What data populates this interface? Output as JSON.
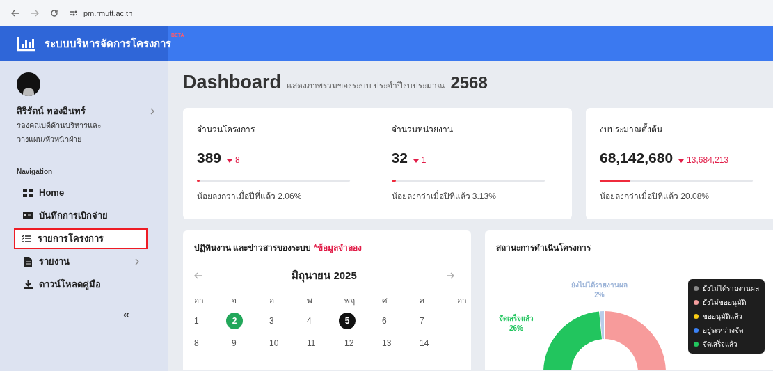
{
  "browser": {
    "url": "pm.rmutt.ac.th"
  },
  "header": {
    "title": "ระบบบริหารจัดการโครงการ",
    "badge": "BETA"
  },
  "user": {
    "name": "สิริรัตน์ ทองอินทร์",
    "role": "รองคณบดีด้านบริหารและวางแผน/หัวหน้าฝ่าย"
  },
  "nav": {
    "heading": "Navigation",
    "items": [
      {
        "label": "Home",
        "kind": "grid",
        "selected": false,
        "expandable": false
      },
      {
        "label": "บันทึกการเบิกจ่าย",
        "kind": "card",
        "selected": false,
        "expandable": false
      },
      {
        "label": "รายการโครงการ",
        "kind": "list",
        "selected": true,
        "expandable": false
      },
      {
        "label": "รายงาน",
        "kind": "file",
        "selected": false,
        "expandable": true
      },
      {
        "label": "ดาวน์โหลดคู่มือ",
        "kind": "download",
        "selected": false,
        "expandable": false
      }
    ],
    "collapse": "«"
  },
  "dashboard": {
    "title": "Dashboard",
    "subtitle": "แสดงภาพรวมของระบบ ประจำปีงบประมาณ",
    "year": "2568"
  },
  "stats": [
    {
      "label": "จำนวนโครงการ",
      "value": "389",
      "change": "8",
      "level": 0.02,
      "note": "น้อยลงกว่าเมื่อปีที่แล้ว 2.06%"
    },
    {
      "label": "จำนวนหน่วยงาน",
      "value": "32",
      "change": "1",
      "level": 0.03,
      "note": "น้อยลงกว่าเมื่อปีที่แล้ว 3.13%"
    },
    {
      "label": "งบประมาณตั้งต้น",
      "value": "68,142,680",
      "change": "13,684,213",
      "level": 0.2,
      "note": "น้อยลงกว่าเมื่อปีที่แล้ว 20.08%"
    }
  ],
  "calendar": {
    "title": "ปฏิทินงาน และข่าวสารของระบบ",
    "title_note": "*ข้อมูลจำลอง",
    "month": "มิถุนายน 2025",
    "weekdays": [
      "อา",
      "จ",
      "อ",
      "พ",
      "พฤ",
      "ศ",
      "ส",
      "อา"
    ],
    "weeks": [
      [
        {
          "day": "1"
        },
        {
          "day": "2",
          "color": "#22a75a"
        },
        {
          "day": "3"
        },
        {
          "day": "4"
        },
        {
          "day": "5",
          "color": "#111111"
        },
        {
          "day": "6"
        },
        {
          "day": "7"
        }
      ],
      [
        {
          "day": "8"
        },
        {
          "day": "9"
        },
        {
          "day": "10"
        },
        {
          "day": "11"
        },
        {
          "day": "12"
        },
        {
          "day": "13"
        },
        {
          "day": "14"
        }
      ]
    ]
  },
  "status": {
    "title": "สถานะการดำเนินโครงการ",
    "labels": [
      {
        "name": "ยังไม่ได้รายงานผล",
        "value": "2%",
        "color": "#9cb4d8"
      },
      {
        "name": "จัดเสร็จแล้ว",
        "value": "26%",
        "color": "#22c55e"
      }
    ],
    "legend": [
      {
        "label": "ยังไม่ได้รายงานผล",
        "color": "#8a8a8a"
      },
      {
        "label": "ยังไม่ขออนุมัติ",
        "color": "#f59e9e"
      },
      {
        "label": "ขออนุมัติแล้ว",
        "color": "#facc15"
      },
      {
        "label": "อยู่ระหว่างจัด",
        "color": "#3b82f6"
      },
      {
        "label": "จัดเสร็จแล้ว",
        "color": "#22c55e"
      }
    ]
  }
}
